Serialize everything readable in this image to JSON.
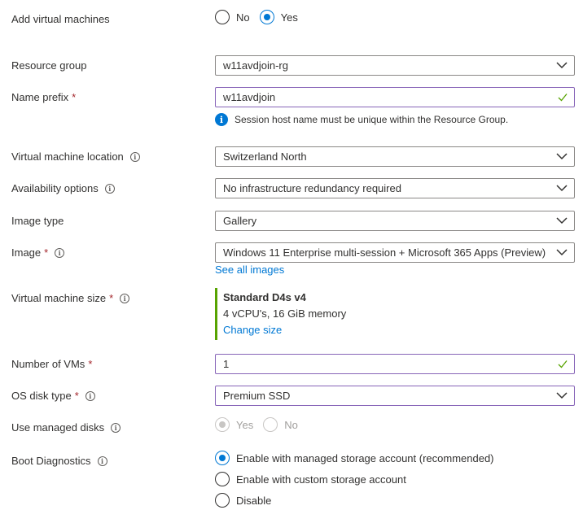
{
  "add_vms": {
    "label": "Add virtual machines",
    "options": [
      "No",
      "Yes"
    ],
    "selected": "Yes"
  },
  "resource_group": {
    "label": "Resource group",
    "value": "w11avdjoin-rg"
  },
  "name_prefix": {
    "label": "Name prefix",
    "required": "*",
    "value": "w11avdjoin",
    "note": "Session host name must be unique within the Resource Group."
  },
  "vm_location": {
    "label": "Virtual machine location",
    "value": "Switzerland North"
  },
  "availability": {
    "label": "Availability options",
    "value": "No infrastructure redundancy required"
  },
  "image_type": {
    "label": "Image type",
    "value": "Gallery"
  },
  "image": {
    "label": "Image",
    "required": "*",
    "value": "Windows 11 Enterprise multi-session + Microsoft 365 Apps (Preview)",
    "link": "See all images"
  },
  "vm_size": {
    "label": "Virtual machine size",
    "required": "*",
    "name": "Standard D4s v4",
    "specs": "4 vCPU's, 16 GiB memory",
    "link": "Change size"
  },
  "num_vms": {
    "label": "Number of VMs",
    "required": "*",
    "value": "1"
  },
  "os_disk": {
    "label": "OS disk type",
    "required": "*",
    "value": "Premium SSD"
  },
  "managed_disks": {
    "label": "Use managed disks",
    "options": [
      "Yes",
      "No"
    ],
    "selected": "Yes",
    "disabled": true
  },
  "boot_diag": {
    "label": "Boot Diagnostics",
    "options": [
      "Enable with managed storage account (recommended)",
      "Enable with custom storage account",
      "Disable"
    ],
    "selected": "Enable with managed storage account (recommended)"
  },
  "colors": {
    "accent": "#0078d4",
    "active_border": "#8764b8",
    "success": "#57a300",
    "required": "#a4262c"
  }
}
